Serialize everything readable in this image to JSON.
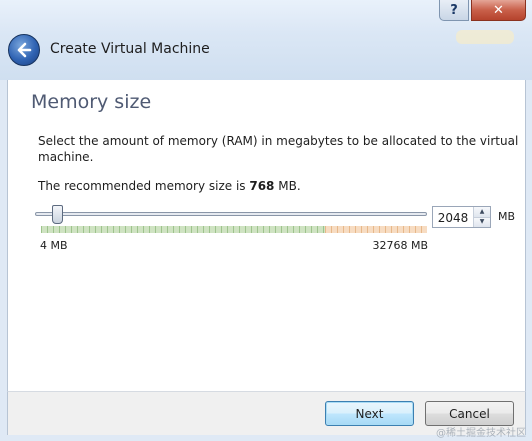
{
  "window": {
    "help_label": "?",
    "close_label": "✕",
    "title": "Create Virtual Machine"
  },
  "page": {
    "heading": "Memory size",
    "description": "Select the amount of memory (RAM) in megabytes to be allocated to the virtual machine.",
    "recommend_prefix": "The recommended memory size is ",
    "recommend_value": "768",
    "recommend_suffix": " MB."
  },
  "memory": {
    "value": "2048",
    "unit": "MB",
    "min_label": "4 MB",
    "max_label": "32768 MB",
    "slider_fraction": 0.0624
  },
  "footer": {
    "next_label": "Next",
    "cancel_label": "Cancel"
  },
  "watermark": "@稀土掘金技术社区",
  "colors": {
    "accent": "#3c7fb1",
    "safe_range": "#9ec38d",
    "warn_range": "#e7b88a"
  },
  "icons": {
    "back": "back-arrow-icon",
    "spin_up": "spin-up-icon",
    "spin_down": "spin-down-icon"
  }
}
